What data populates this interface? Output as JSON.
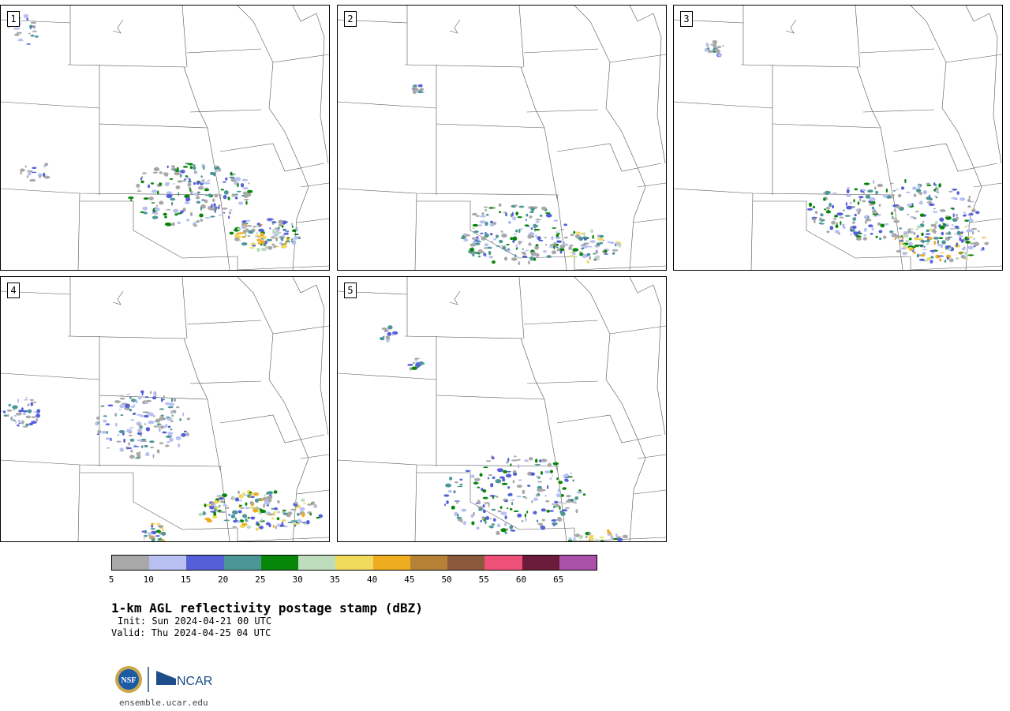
{
  "panels": [
    "1",
    "2",
    "3",
    "4",
    "5"
  ],
  "colorbar": {
    "colors": [
      "#a8a8a8",
      "#b7c0f0",
      "#5560d8",
      "#4d9698",
      "#08860a",
      "#bcdcbc",
      "#f0da5e",
      "#eeac20",
      "#b68336",
      "#8b5a3c",
      "#ee5078",
      "#6c1c3a",
      "#aa50aa"
    ],
    "ticks": [
      "5",
      "10",
      "15",
      "20",
      "25",
      "30",
      "35",
      "40",
      "45",
      "50",
      "55",
      "60",
      "65"
    ]
  },
  "title": "1-km AGL reflectivity postage stamp (dBZ)",
  "init": "Init: Sun 2024-04-21 00 UTC",
  "valid": "Valid: Thu 2024-04-25 04 UTC",
  "logo": {
    "left": "NSF",
    "right": "NCAR"
  },
  "website": "ensemble.ucar.edu"
}
